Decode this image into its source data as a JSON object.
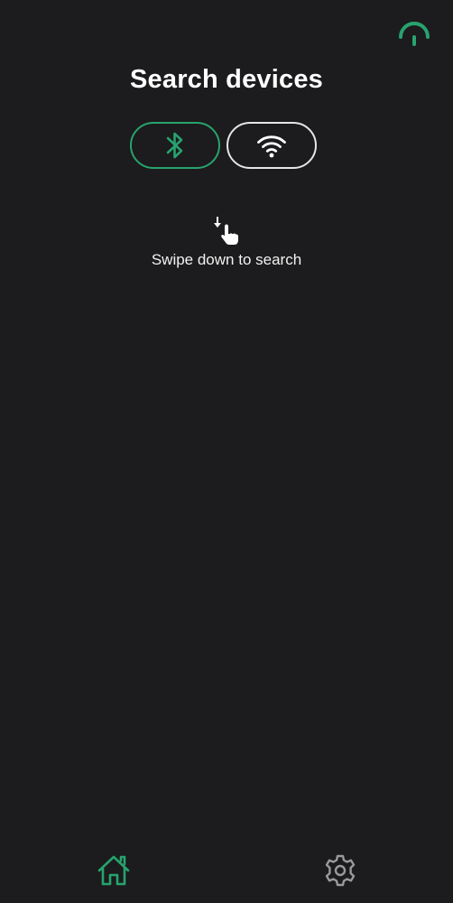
{
  "header": {
    "title": "Search devices",
    "top_right_icon": "antenna-icon"
  },
  "connection_toggle": {
    "options": [
      {
        "name": "bluetooth",
        "icon": "bluetooth-icon",
        "selected": true
      },
      {
        "name": "wifi",
        "icon": "wifi-icon",
        "selected": false
      }
    ]
  },
  "empty_state": {
    "icon": "swipe-down-hand-icon",
    "text": "Swipe down to search"
  },
  "bottom_nav": {
    "items": [
      {
        "name": "home",
        "icon": "home-icon",
        "active": true
      },
      {
        "name": "settings",
        "icon": "gear-icon",
        "active": false
      }
    ]
  },
  "colors": {
    "background": "#1c1b1d",
    "accent": "#27a36e",
    "text": "#ffffff",
    "inactive_icon": "#9a9a9a"
  }
}
